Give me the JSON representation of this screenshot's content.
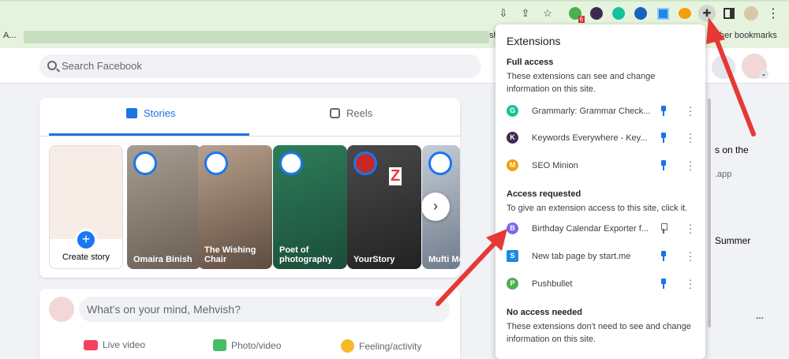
{
  "bookmarks": {
    "left_text": "A...",
    "mid_text": "sh",
    "right_text": "her bookmarks"
  },
  "toolbar": {
    "icons": [
      "download-icon",
      "share-icon",
      "star-icon"
    ],
    "ext_badge": "6",
    "menu": "⋮"
  },
  "fb": {
    "search_placeholder": "Search Facebook",
    "tabs": {
      "stories": "Stories",
      "reels": "Reels"
    },
    "stories": [
      {
        "label": "Create story"
      },
      {
        "label": "Omaira Binish"
      },
      {
        "label": "The Wishing Chair"
      },
      {
        "label": "Poet of photography"
      },
      {
        "label": "YourStory"
      },
      {
        "label": "Mufti Me"
      }
    ],
    "composer_placeholder": "What's on your mind, Mehvish?",
    "actions": {
      "live": "Live video",
      "photo": "Photo/video",
      "feeling": "Feeling/activity"
    },
    "right": {
      "text1": "s on the",
      "text2": ".app",
      "text3": "Summer",
      "more": "..."
    }
  },
  "extensions": {
    "title": "Extensions",
    "full_access": {
      "heading": "Full access",
      "desc": "These extensions can see and change information on this site.",
      "items": [
        {
          "name": "Grammarly: Grammar Check...",
          "color": "#15c39a",
          "glyph": "G"
        },
        {
          "name": "Keywords Everywhere - Key...",
          "color": "#3d2b4f",
          "glyph": "K"
        },
        {
          "name": "SEO Minion",
          "color": "#f59e0b",
          "glyph": "M"
        }
      ]
    },
    "access_requested": {
      "heading": "Access requested",
      "desc": "To give an extension access to this site, click it.",
      "items": [
        {
          "name": "Birthday Calendar Exporter f...",
          "color": "#7b68ee",
          "glyph": "B"
        },
        {
          "name": "New tab page by start.me",
          "color": "#1e88e5",
          "glyph": "S"
        },
        {
          "name": "Pushbullet",
          "color": "#4caf50",
          "glyph": "P"
        }
      ]
    },
    "no_access": {
      "heading": "No access needed",
      "desc": "These extensions don't need to see and change information on this site."
    }
  },
  "annotation": {
    "letter": "Z"
  }
}
